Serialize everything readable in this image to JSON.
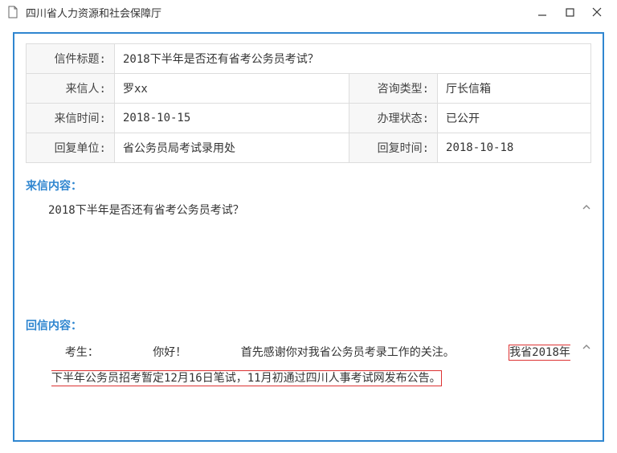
{
  "window": {
    "title": "四川省人力资源和社会保障厅"
  },
  "fields": {
    "subject_label": "信件标题:",
    "subject_value": "2018下半年是否还有省考公务员考试？",
    "sender_label": "来信人:",
    "sender_value": "罗xx",
    "type_label": "咨询类型:",
    "type_value": "厅长信箱",
    "sent_label": "来信时间:",
    "sent_value": "2018-10-15",
    "status_label": "办理状态:",
    "status_value": "已公开",
    "dept_label": "回复单位:",
    "dept_value": "省公务员局考试录用处",
    "reply_time_label": "回复时间:",
    "reply_time_value": "2018-10-18"
  },
  "incoming": {
    "heading": "来信内容：",
    "body": "2018下半年是否还有省考公务员考试？"
  },
  "reply": {
    "heading": "回信内容：",
    "salutation_prefix": "考生：",
    "salutation_greet": "你好！",
    "intro": "首先感谢你对我省公务员考录工作的关注。",
    "highlight": "我省2018年下半年公务员招考暂定12月16日笔试，11月初通过四川人事考试网发布公告。"
  }
}
